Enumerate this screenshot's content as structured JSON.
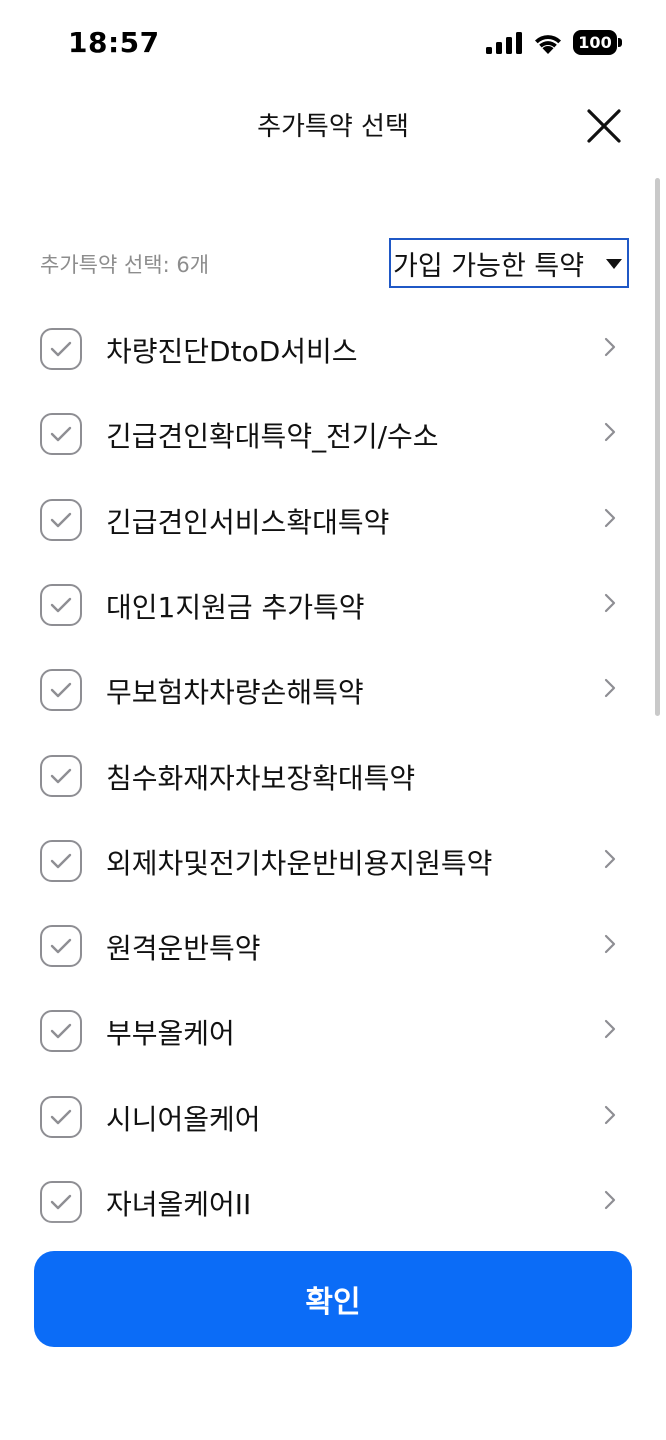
{
  "status_bar": {
    "time": "18:57",
    "battery": "100",
    "icons": [
      "signal-icon",
      "wifi-icon",
      "battery-icon"
    ]
  },
  "header": {
    "title": "추가특약 선택",
    "close_icon": "close-icon"
  },
  "summary": {
    "count_label": "추가특약 선택: 6개"
  },
  "filter": {
    "selected": "가입 가능한 특약",
    "icon": "caret-down-icon"
  },
  "items": [
    {
      "label": "차량진단DtoD서비스",
      "checked": true,
      "has_chevron": true
    },
    {
      "label": "긴급견인확대특약_전기/수소",
      "checked": true,
      "has_chevron": true
    },
    {
      "label": "긴급견인서비스확대특약",
      "checked": true,
      "has_chevron": true
    },
    {
      "label": "대인1지원금 추가특약",
      "checked": true,
      "has_chevron": true
    },
    {
      "label": "무보험차차량손해특약",
      "checked": true,
      "has_chevron": true
    },
    {
      "label": "침수화재자차보장확대특약",
      "checked": true,
      "has_chevron": false
    },
    {
      "label": "외제차및전기차운반비용지원특약",
      "checked": true,
      "has_chevron": true
    },
    {
      "label": "원격운반특약",
      "checked": true,
      "has_chevron": true
    },
    {
      "label": "부부올케어",
      "checked": true,
      "has_chevron": true
    },
    {
      "label": "시니어올케어",
      "checked": true,
      "has_chevron": true
    },
    {
      "label": "자녀올케어II",
      "checked": true,
      "has_chevron": true
    }
  ],
  "confirm": {
    "label": "확인"
  },
  "colors": {
    "primary": "#0b6cf7",
    "filter_border": "#1f58c6",
    "checkbox_border": "#8e8e93",
    "muted_text": "#8d8d8d"
  }
}
